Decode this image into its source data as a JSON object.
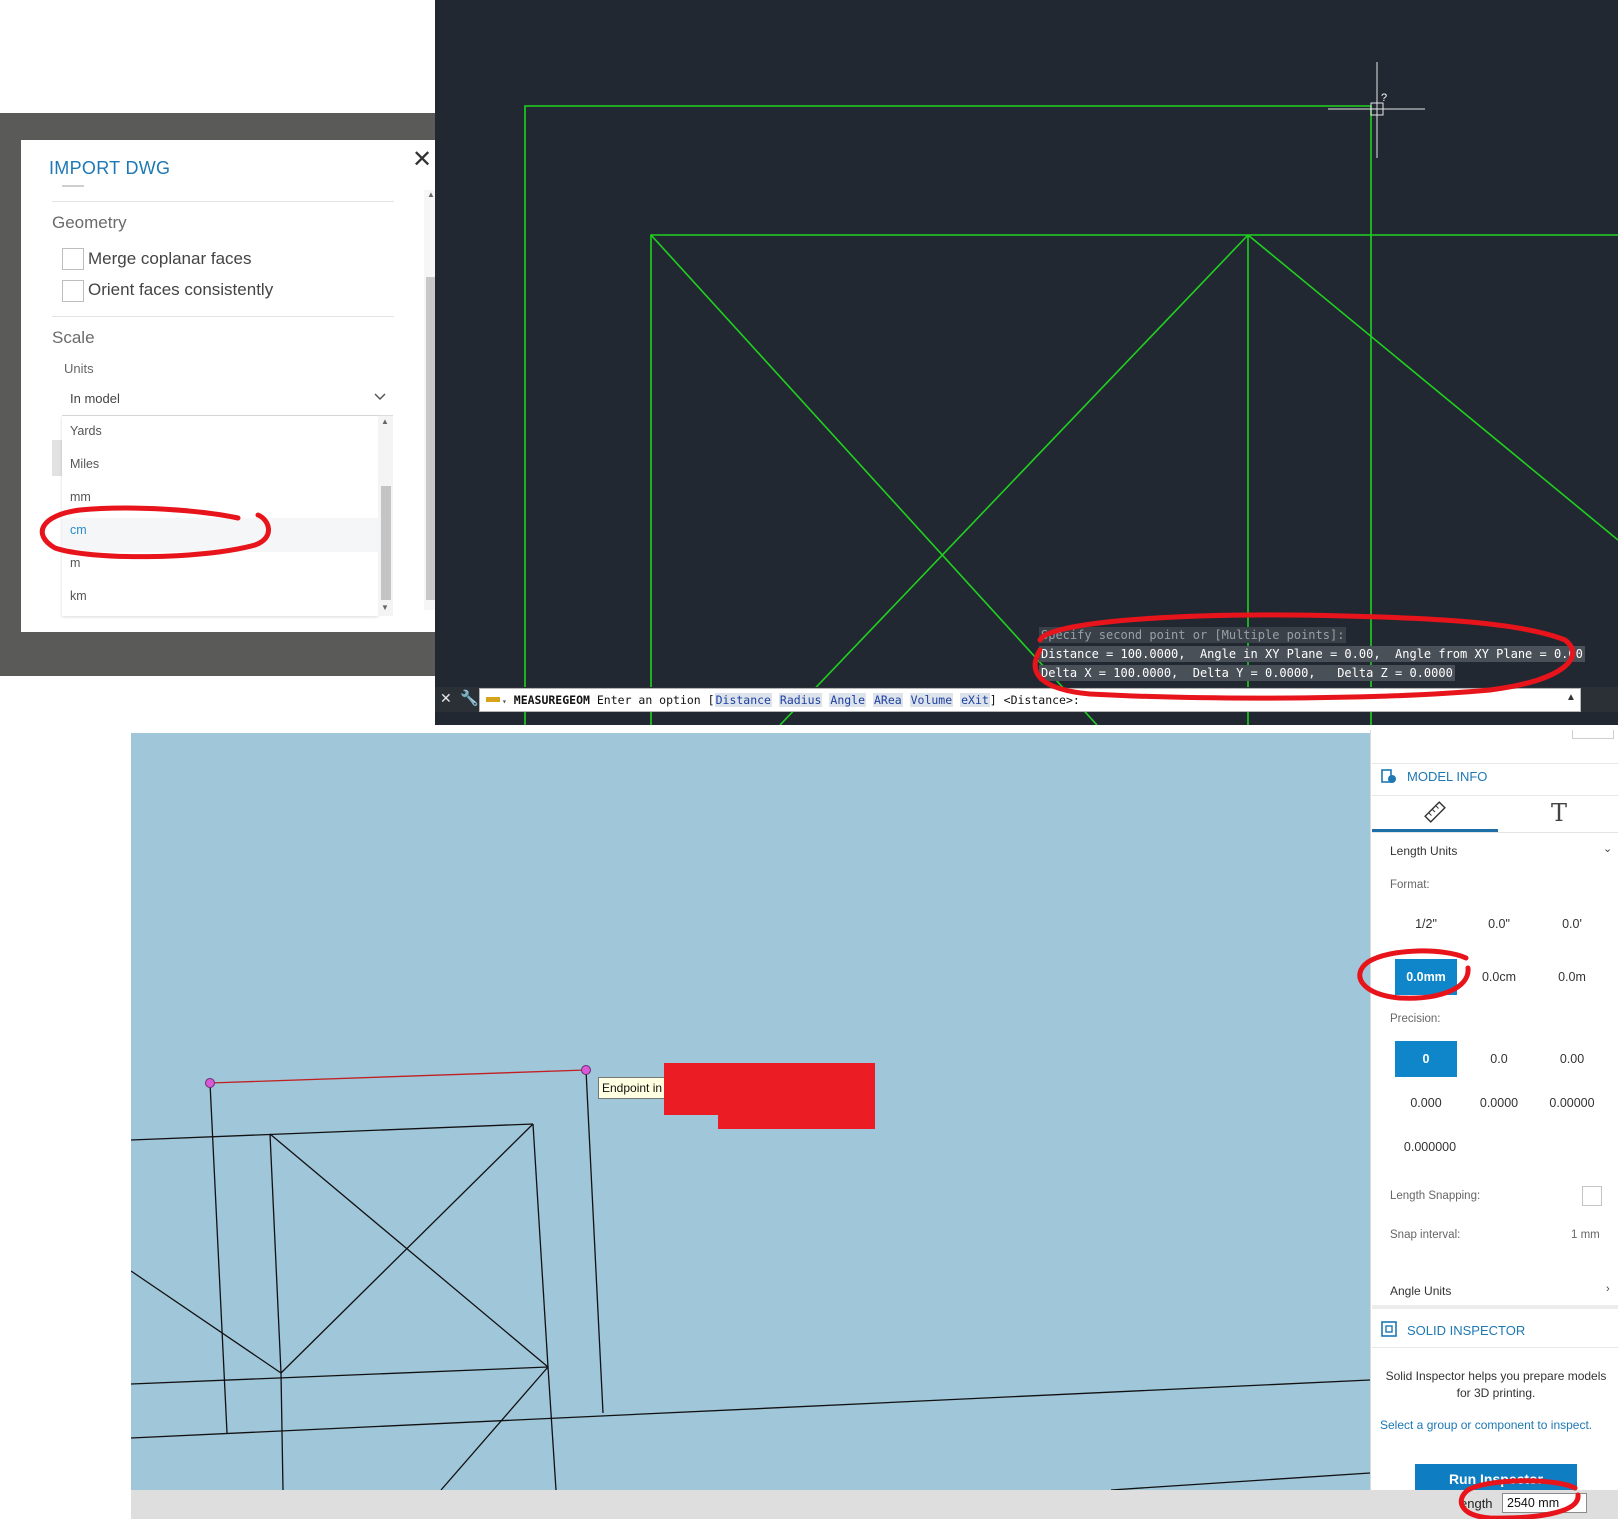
{
  "import_dialog": {
    "title": "IMPORT DWG",
    "close_glyph": "✕",
    "geometry": {
      "heading": "Geometry",
      "options": [
        {
          "label": "Merge coplanar faces",
          "checked": false
        },
        {
          "label": "Orient faces consistently",
          "checked": false
        }
      ]
    },
    "scale": {
      "heading": "Scale",
      "units_label": "Units",
      "selected": "In model",
      "options": [
        "Yards",
        "Miles",
        "mm",
        "cm",
        "m",
        "km"
      ],
      "highlighted": "cm"
    }
  },
  "cad": {
    "cursor_label": "?",
    "output": {
      "prompt": "Specify second point or [Multiple points]:",
      "distance": "Distance = 100.0000,  Angle in XY Plane = 0.00,  Angle from XY Plane = 0.00",
      "delta": "Delta X = 100.0000,  Delta Y = 0.0000,   Delta Z = 0.0000"
    },
    "command_line": {
      "command": "MEASUREGEOM",
      "text": "Enter an option",
      "options": [
        "Distance",
        "Radius",
        "Angle",
        "ARea",
        "Volume",
        "eXit"
      ],
      "default": "<Distance>:"
    }
  },
  "sketchup": {
    "tooltip": "Endpoint in",
    "model_info": {
      "title": "MODEL INFO",
      "length_units": "Length Units",
      "format_label": "Format:",
      "formats": [
        "1/2\"",
        "0.0\"",
        "0.0'",
        "0.0mm",
        "0.0cm",
        "0.0m"
      ],
      "selected_format": "0.0mm",
      "precision_label": "Precision:",
      "precisions": [
        "0",
        "0.0",
        "0.00",
        "0.000",
        "0.0000",
        "0.00000",
        "0.000000"
      ],
      "selected_precision": "0",
      "length_snapping": "Length Snapping:",
      "snap_interval_label": "Snap interval:",
      "snap_interval": "1 mm",
      "angle_units": "Angle Units"
    },
    "solid_inspector": {
      "title": "SOLID INSPECTOR",
      "description": "Solid Inspector helps you prepare models for 3D printing.",
      "hint": "Select a group or component to inspect.",
      "button": "Run Inspector"
    },
    "status": {
      "length_label": "ength",
      "length_value": "2540 mm"
    }
  },
  "colors": {
    "cad_background": "#222831",
    "cad_lines": "#1fd11f",
    "sketchup_background": "#a0c6da",
    "accent": "#1e78b4",
    "selected": "#0f86c9",
    "annotation": "#e8141b"
  }
}
